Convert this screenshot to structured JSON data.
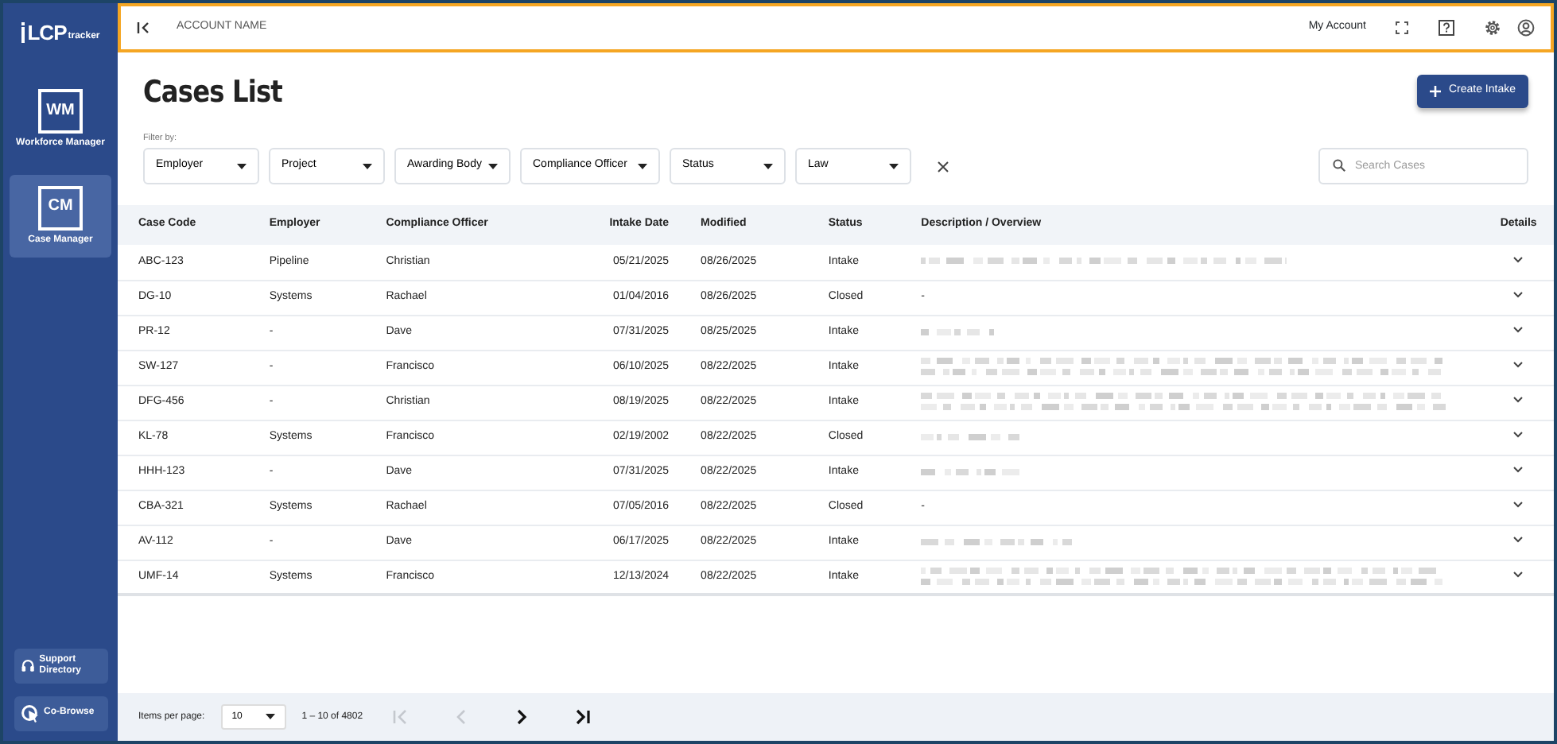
{
  "sidebar": {
    "logo": {
      "main": "LCP",
      "sub": "tracker"
    },
    "apps": [
      {
        "code": "WM",
        "label": "Workforce Manager",
        "selected": false
      },
      {
        "code": "CM",
        "label": "Case Manager",
        "selected": true
      }
    ],
    "footer_links": [
      {
        "label": "Support Directory",
        "kind": "support"
      },
      {
        "label": "Co-Browse",
        "kind": "cobrowse"
      }
    ]
  },
  "top_bar": {
    "account_name": "ACCOUNT NAME",
    "my_account": "My Account"
  },
  "page": {
    "title": "Cases List",
    "create_button": "Create Intake",
    "filter_label": "Filter by:",
    "filters": [
      "Employer",
      "Project",
      "Awarding Body",
      "Compliance Officer",
      "Status",
      "Law"
    ],
    "search": {
      "placeholder": "Search Cases"
    }
  },
  "table": {
    "columns": [
      "Case Code",
      "Employer",
      "Compliance Officer",
      "Intake Date",
      "Modified",
      "Status",
      "Description / Overview",
      "Details"
    ],
    "rows": [
      {
        "code": "ABC-123",
        "employer": "Pipeline",
        "officer": "Christian",
        "intake": "05/21/2025",
        "modified": "08/26/2025",
        "status": "Intake",
        "description": {
          "kind": "blurwide"
        }
      },
      {
        "code": "DG-10",
        "employer": "Systems",
        "officer": "Rachael",
        "intake": "01/04/2016",
        "modified": "08/26/2025",
        "status": "Closed",
        "description": {
          "kind": "text",
          "text": "-"
        }
      },
      {
        "code": "PR-12",
        "employer": "-",
        "officer": "Dave",
        "intake": "07/31/2025",
        "modified": "08/25/2025",
        "status": "Intake",
        "description": {
          "kind": "blurtiny"
        }
      },
      {
        "code": "SW-127",
        "employer": "-",
        "officer": "Francisco",
        "intake": "06/10/2025",
        "modified": "08/22/2025",
        "status": "Intake",
        "description": {
          "kind": "blurparagraph"
        }
      },
      {
        "code": "DFG-456",
        "employer": "-",
        "officer": "Christian",
        "intake": "08/19/2025",
        "modified": "08/22/2025",
        "status": "Intake",
        "description": {
          "kind": "blurparagraph"
        }
      },
      {
        "code": "KL-78",
        "employer": "Systems",
        "officer": "Francisco",
        "intake": "02/19/2002",
        "modified": "08/22/2025",
        "status": "Closed",
        "description": {
          "kind": "blurshort"
        }
      },
      {
        "code": "HHH-123",
        "employer": "-",
        "officer": "Dave",
        "intake": "07/31/2025",
        "modified": "08/22/2025",
        "status": "Intake",
        "description": {
          "kind": "blurshort"
        }
      },
      {
        "code": "CBA-321",
        "employer": "Systems",
        "officer": "Rachael",
        "intake": "07/05/2016",
        "modified": "08/22/2025",
        "status": "Closed",
        "description": {
          "kind": "text",
          "text": "-"
        }
      },
      {
        "code": "AV-112",
        "employer": "-",
        "officer": "Dave",
        "intake": "06/17/2025",
        "modified": "08/22/2025",
        "status": "Intake",
        "description": {
          "kind": "blurmedium"
        }
      },
      {
        "code": "UMF-14",
        "employer": "Systems",
        "officer": "Francisco",
        "intake": "12/13/2024",
        "modified": "08/22/2025",
        "status": "Intake",
        "description": {
          "kind": "blurparagraph"
        }
      }
    ]
  },
  "pagination": {
    "items_per_page_label": "Items per page:",
    "per_page": "10",
    "range": "1 – 10 of 4802",
    "nav": [
      {
        "kind": "first",
        "disabled": true
      },
      {
        "kind": "prev",
        "disabled": true
      },
      {
        "kind": "next",
        "disabled": false
      },
      {
        "kind": "last",
        "disabled": false
      }
    ]
  }
}
